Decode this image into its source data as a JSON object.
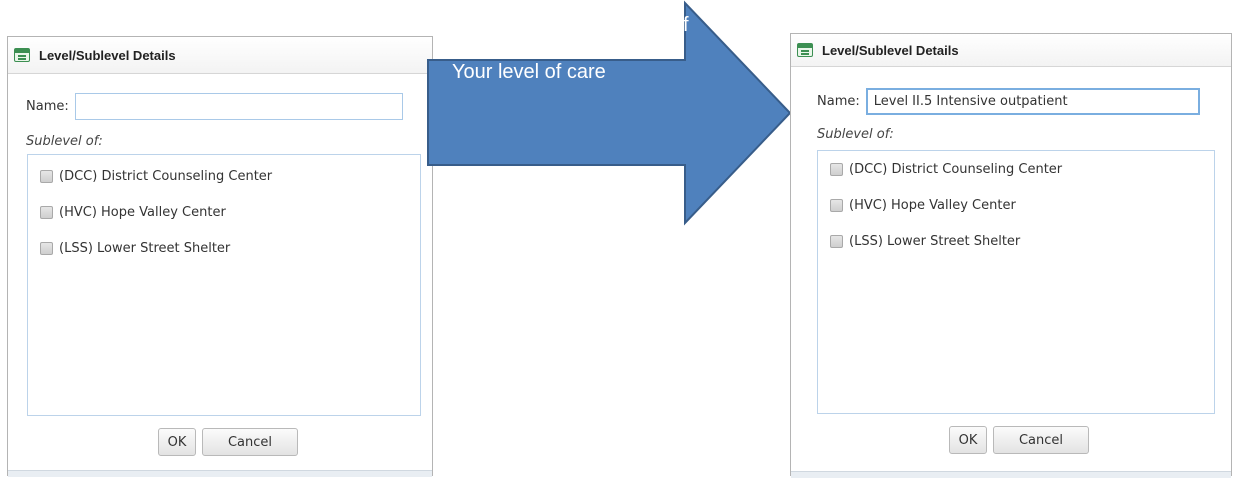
{
  "arrow": {
    "label": "Your level of care",
    "stray_glyph": "f",
    "fill_color": "#4f81bd",
    "stroke_color": "#385d8a"
  },
  "left_dialog": {
    "title": "Level/Sublevel Details",
    "name_label": "Name:",
    "name_value": "",
    "sublevel_label": "Sublevel of:",
    "items": [
      {
        "label": "(DCC) District Counseling Center",
        "checked": false
      },
      {
        "label": "(HVC) Hope Valley Center",
        "checked": false
      },
      {
        "label": "(LSS) Lower Street Shelter",
        "checked": false
      }
    ],
    "ok_label": "OK",
    "cancel_label": "Cancel"
  },
  "right_dialog": {
    "title": "Level/Sublevel Details",
    "name_label": "Name:",
    "name_value": "Level II.5 Intensive outpatient",
    "sublevel_label": "Sublevel of:",
    "items": [
      {
        "label": "(DCC) District Counseling Center",
        "checked": false
      },
      {
        "label": "(HVC) Hope Valley Center",
        "checked": false
      },
      {
        "label": "(LSS) Lower Street Shelter",
        "checked": false
      }
    ],
    "ok_label": "OK",
    "cancel_label": "Cancel"
  }
}
